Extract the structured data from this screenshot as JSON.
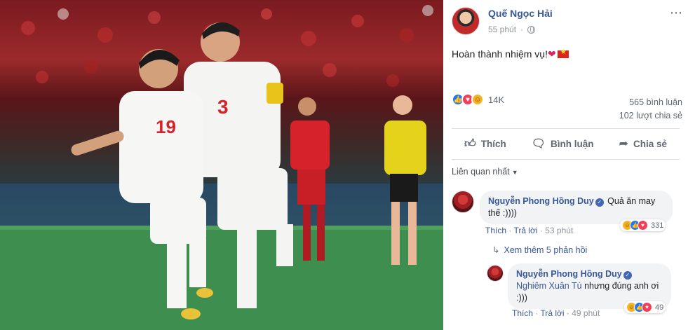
{
  "post": {
    "author": "Quế Ngọc Hải",
    "time": "55 phút",
    "caption": "Hoàn thành nhiệm vụ!",
    "reactions_count": "14K",
    "comments_count": "565 bình luận",
    "shares_count": "102 lượt chia sẻ"
  },
  "actions": {
    "like": "Thích",
    "comment": "Bình luận",
    "share": "Chia sẻ"
  },
  "sort": {
    "label": "Liên quan nhất"
  },
  "comments": [
    {
      "author": "Nguyễn Phong Hồng Duy",
      "text": "Quả ăn may thế :))))",
      "like_label": "Thích",
      "reply_label": "Trả lời",
      "time": "53 phút",
      "reaction_count": "331"
    }
  ],
  "more_replies": "Xem thêm 5 phản hồi",
  "replies": [
    {
      "author": "Nguyễn Phong Hồng Duy",
      "mention": "Nghiêm Xuân Tú",
      "text": "nhưng đúng anh ơi :)))",
      "like_label": "Thích",
      "reply_label": "Trả lời",
      "time": "49 phút",
      "reaction_count": "49"
    }
  ],
  "photo": {
    "player_numbers": [
      "19",
      "3"
    ]
  },
  "colors": {
    "link": "#385898",
    "like": "#2078f4",
    "love": "#f33e58",
    "haha": "#f7b125"
  }
}
